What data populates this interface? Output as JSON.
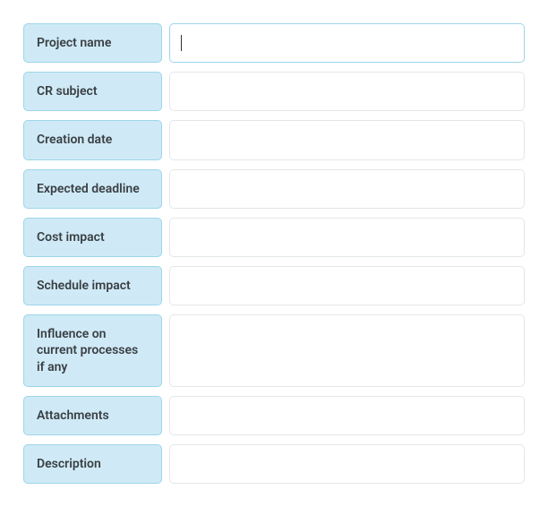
{
  "form": {
    "fields": [
      {
        "id": "project-name",
        "label": "Project name",
        "value": "",
        "active": true,
        "tall": false
      },
      {
        "id": "cr-subject",
        "label": "CR subject",
        "value": "",
        "active": false,
        "tall": false
      },
      {
        "id": "creation-date",
        "label": "Creation date",
        "value": "",
        "active": false,
        "tall": false
      },
      {
        "id": "expected-deadline",
        "label": "Expected deadline",
        "value": "",
        "active": false,
        "tall": false
      },
      {
        "id": "cost-impact",
        "label": "Cost impact",
        "value": "",
        "active": false,
        "tall": false
      },
      {
        "id": "schedule-impact",
        "label": "Schedule impact",
        "value": "",
        "active": false,
        "tall": false
      },
      {
        "id": "influence",
        "label": "Influence on current processes if any",
        "value": "",
        "active": false,
        "tall": true
      },
      {
        "id": "attachments",
        "label": "Attachments",
        "value": "",
        "active": false,
        "tall": false
      },
      {
        "id": "description",
        "label": "Description",
        "value": "",
        "active": false,
        "tall": false
      }
    ]
  },
  "colors": {
    "label_bg": "#cfeaf6",
    "label_border": "#9dd5ea",
    "input_border": "#e3e6e8",
    "input_border_active": "#9dd5ea"
  }
}
